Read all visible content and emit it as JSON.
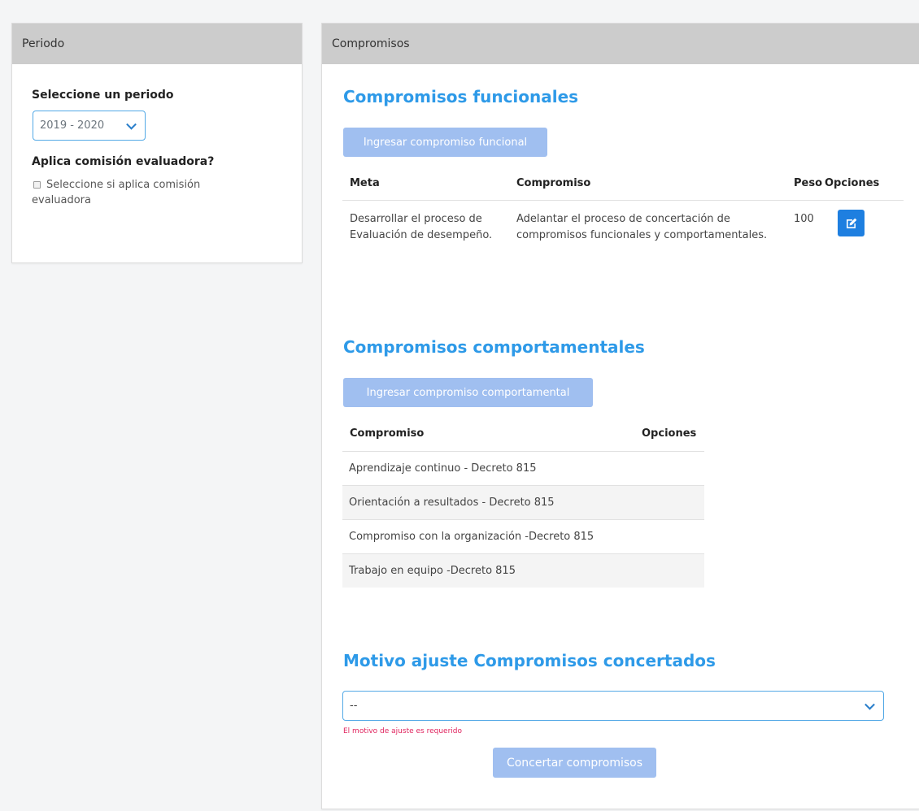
{
  "periodo_panel": {
    "header": "Periodo",
    "select_label": "Seleccione un periodo",
    "select_value": "2019 - 2020",
    "comision_label": "Aplica comisión evaluadora?",
    "checkbox_text": "Seleccione si aplica comisión evaluadora"
  },
  "compromisos_panel": {
    "header": "Compromisos",
    "funcionales": {
      "title": "Compromisos funcionales",
      "add_button": "Ingresar compromiso funcional",
      "columns": [
        "Meta",
        "Compromiso",
        "Peso",
        "Opciones"
      ],
      "rows": [
        {
          "meta": "Desarrollar el proceso de Evaluación de desempeño.",
          "compromiso": "Adelantar el proceso de concertación de compromisos funcionales y comportamentales.",
          "peso": "100"
        }
      ]
    },
    "comportamentales": {
      "title": "Compromisos comportamentales",
      "add_button": "Ingresar compromiso comportamental",
      "columns": [
        "Compromiso",
        "Opciones"
      ],
      "rows": [
        "Aprendizaje continuo - Decreto 815",
        "Orientación a resultados - Decreto 815",
        "Compromiso con la organización -Decreto 815",
        "Trabajo en equipo -Decreto 815"
      ]
    },
    "motivo": {
      "title": "Motivo ajuste Compromisos concertados",
      "select_value": "--",
      "error": "El motivo de ajuste es requerido",
      "submit_button": "Concertar compromisos"
    }
  },
  "colors": {
    "accent": "#2e9ae8",
    "header_bg": "#cccccc",
    "button_disabled": "#a0bff0",
    "edit_button": "#1e7fe0",
    "error": "#e0245e"
  },
  "icons": {
    "edit": "edit-icon",
    "dropdown": "chevron-down-icon",
    "checkbox": "checkbox-icon"
  }
}
